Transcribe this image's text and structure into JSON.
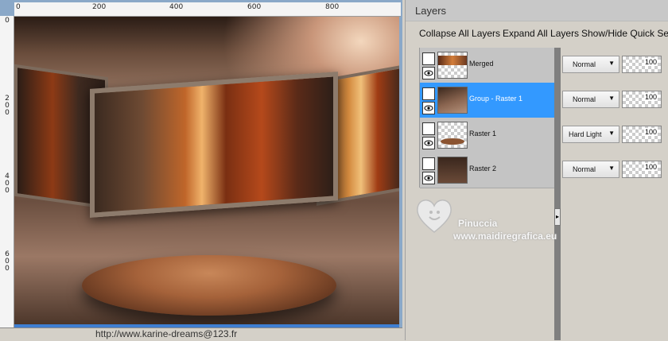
{
  "ruler_top": {
    "labels": [
      "0",
      "200",
      "400",
      "600",
      "800"
    ]
  },
  "ruler_left": {
    "labels": [
      "0",
      "200",
      "400",
      "600"
    ]
  },
  "canvas": {
    "bottom_text": "http://www.karine-dreams@123.fr"
  },
  "panel": {
    "title": "Layers",
    "toolbar": {
      "collapse": "Collapse All Layers",
      "expand": "Expand All Layers",
      "quick_search": "Show/Hide Quick Sea"
    }
  },
  "layers": [
    {
      "name": "Merged",
      "blend": "Normal",
      "opacity": "100",
      "selected": false
    },
    {
      "name": "Group - Raster 1",
      "blend": "Normal",
      "opacity": "100",
      "selected": true
    },
    {
      "name": "Raster 1",
      "blend": "Hard Light",
      "opacity": "100",
      "selected": false
    },
    {
      "name": "Raster 2",
      "blend": "Normal",
      "opacity": "100",
      "selected": false
    }
  ],
  "watermark": {
    "name": "Pinuccia",
    "site": "www.maidiregrafica.eu"
  },
  "colors": {
    "selection": "#3399ff",
    "panel_bg": "#d4d0c8",
    "scroll_accent": "#3f7fd2"
  }
}
